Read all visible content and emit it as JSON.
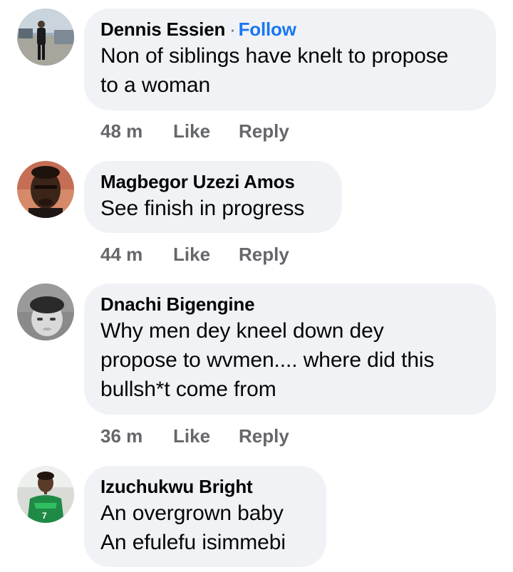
{
  "comments": [
    {
      "author": "Dennis Essien",
      "separator": "·",
      "follow_label": "Follow",
      "lines": [
        "Non of siblings have knelt to propose",
        "to a woman"
      ],
      "time": "48 m",
      "like_label": "Like",
      "reply_label": "Reply"
    },
    {
      "author": "Magbegor Uzezi Amos",
      "lines": [
        "See finish in progress"
      ],
      "time": "44 m",
      "like_label": "Like",
      "reply_label": "Reply"
    },
    {
      "author": "Dnachi Bigengine",
      "lines": [
        "Why men dey kneel down dey",
        "propose to wvmen.... where did this",
        "bullsh*t come from"
      ],
      "time": "36 m",
      "like_label": "Like",
      "reply_label": "Reply"
    },
    {
      "author": "Izuchukwu Bright",
      "lines": [
        "An overgrown baby",
        "An efulefu isimmebi"
      ]
    }
  ],
  "colors": {
    "bubble": "#f0f2f5",
    "follow": "#1877f2",
    "meta": "#65676b",
    "text": "#050505"
  }
}
